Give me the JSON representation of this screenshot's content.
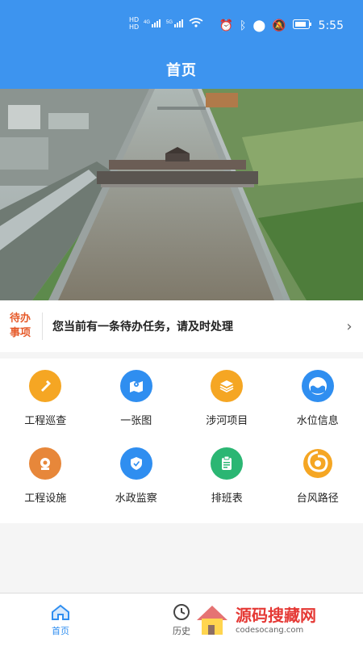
{
  "status": {
    "time": "5:55",
    "left_icons": [
      "hd-1",
      "signal-4g",
      "hd-2",
      "signal-5g",
      "wifi"
    ],
    "right_icons": [
      "alarm",
      "bluetooth",
      "location",
      "mute",
      "battery"
    ]
  },
  "header": {
    "title": "首页"
  },
  "todo": {
    "tag_line1": "待办",
    "tag_line2": "事项",
    "message": "您当前有一条待办任务，请及时处理"
  },
  "features": [
    {
      "label": "工程巡查",
      "color": "#f5a623",
      "icon": "flashlight-icon"
    },
    {
      "label": "一张图",
      "color": "#2f8ef0",
      "icon": "map-icon"
    },
    {
      "label": "涉河项目",
      "color": "#f5a623",
      "icon": "layers-icon"
    },
    {
      "label": "水位信息",
      "color": "#2f8ef0",
      "icon": "water-level-icon"
    },
    {
      "label": "工程设施",
      "color": "#e7873a",
      "icon": "facility-icon"
    },
    {
      "label": "水政监察",
      "color": "#2f8ef0",
      "icon": "shield-icon"
    },
    {
      "label": "排班表",
      "color": "#2bb673",
      "icon": "clipboard-icon"
    },
    {
      "label": "台风路径",
      "color": "#f5a623",
      "icon": "typhoon-icon"
    }
  ],
  "tabs": [
    {
      "label": "首页",
      "icon": "home-icon"
    },
    {
      "label": "历史",
      "icon": "clock-icon"
    }
  ],
  "watermark": {
    "title": "源码搜藏网",
    "url": "codesocang.com"
  }
}
